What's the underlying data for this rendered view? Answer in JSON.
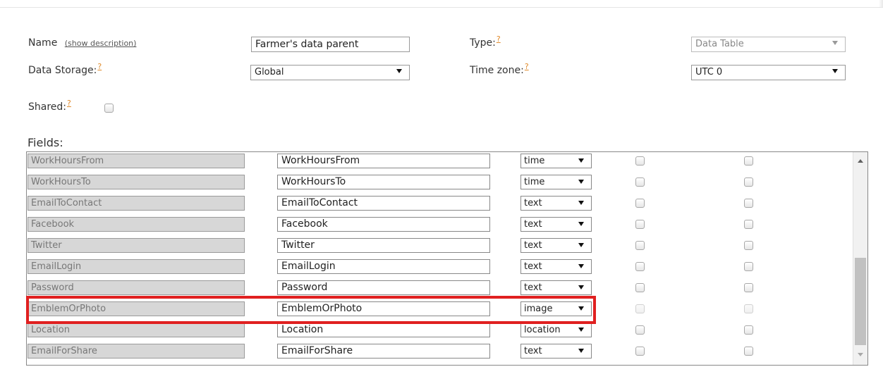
{
  "form": {
    "name_label": "Name",
    "show_description": "(show description)",
    "name_value": "Farmer's data parent",
    "type_label": "Type:",
    "type_value": "Data Table",
    "storage_label": "Data Storage:",
    "storage_value": "Global",
    "timezone_label": "Time zone:",
    "timezone_value": "UTC 0",
    "shared_label": "Shared:",
    "help_mark": "?"
  },
  "fields_title": "Fields:",
  "rows": [
    {
      "system_name": "WorkHoursFrom",
      "display_name": "WorkHoursFrom",
      "type": "time"
    },
    {
      "system_name": "WorkHoursTo",
      "display_name": "WorkHoursTo",
      "type": "time"
    },
    {
      "system_name": "EmailToContact",
      "display_name": "EmailToContact",
      "type": "text"
    },
    {
      "system_name": "Facebook",
      "display_name": "Facebook",
      "type": "text"
    },
    {
      "system_name": "Twitter",
      "display_name": "Twitter",
      "type": "text"
    },
    {
      "system_name": "EmailLogin",
      "display_name": "EmailLogin",
      "type": "text"
    },
    {
      "system_name": "Password",
      "display_name": "Password",
      "type": "text"
    },
    {
      "system_name": "EmblemOrPhoto",
      "display_name": "EmblemOrPhoto",
      "type": "image"
    },
    {
      "system_name": "Location",
      "display_name": "Location",
      "type": "location"
    },
    {
      "system_name": "EmailForShare",
      "display_name": "EmailForShare",
      "type": "text"
    }
  ],
  "colors": {
    "highlight": "#e02020",
    "help": "#e08a2b"
  }
}
